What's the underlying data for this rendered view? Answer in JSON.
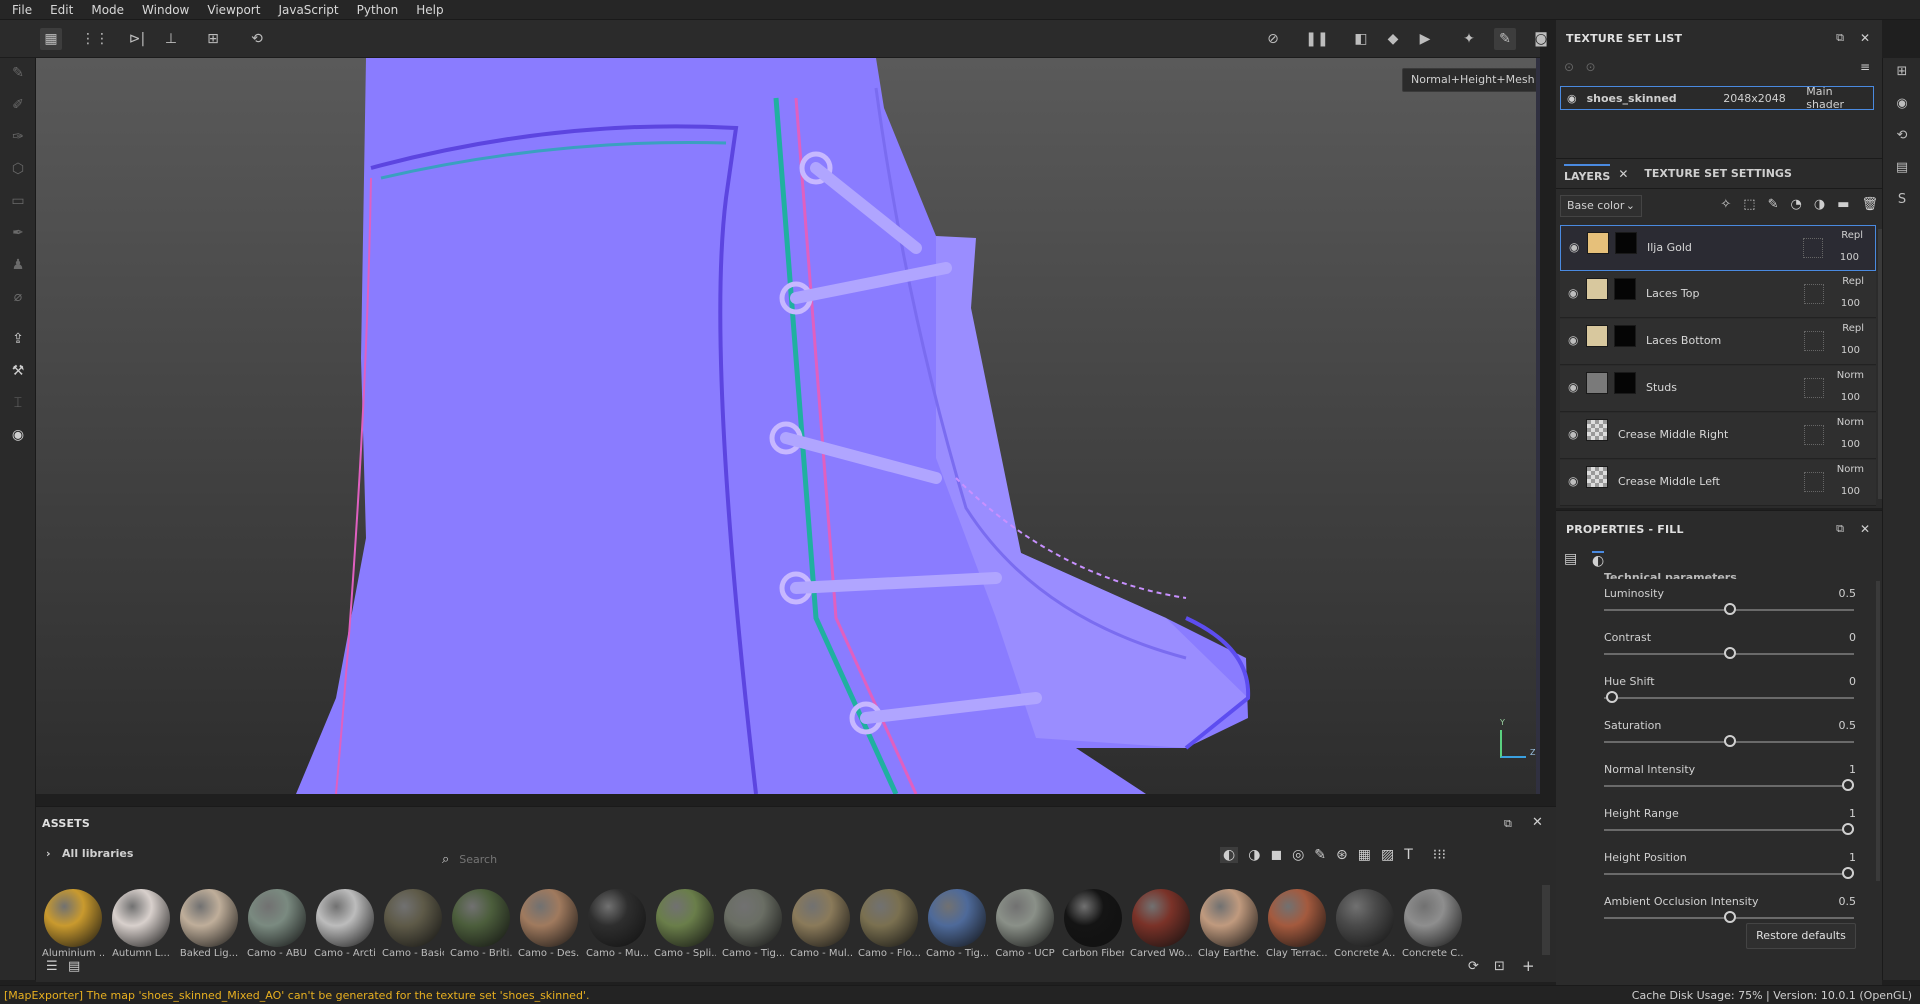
{
  "menu": [
    "File",
    "Edit",
    "Mode",
    "Window",
    "Viewport",
    "JavaScript",
    "Python",
    "Help"
  ],
  "viewport": {
    "mode_dropdown": "Normal+Height+Mesh",
    "axis_y": "Y",
    "axis_z": "Z"
  },
  "texture_set_list": {
    "title": "TEXTURE SET LIST",
    "item": {
      "name": "shoes_skinned",
      "resolution": "2048x2048",
      "shader": "Main shader"
    }
  },
  "layers": {
    "tab_layers": "LAYERS",
    "tab_settings": "TEXTURE SET SETTINGS",
    "channel_dropdown": "Base color",
    "items": [
      {
        "name": "Ilja Gold",
        "blend": "Repl",
        "opacity": "100",
        "color": "#e6c07a"
      },
      {
        "name": "Laces Top",
        "blend": "Repl",
        "opacity": "100",
        "color": "#d8c89e"
      },
      {
        "name": "Laces Bottom",
        "blend": "Repl",
        "opacity": "100",
        "color": "#d8c89e"
      },
      {
        "name": "Studs",
        "blend": "Norm",
        "opacity": "100",
        "color": "#7a7a7a"
      },
      {
        "name": "Crease Middle Right",
        "blend": "Norm",
        "opacity": "100",
        "color": "checker"
      },
      {
        "name": "Crease Middle Left",
        "blend": "Norm",
        "opacity": "100",
        "color": "checker"
      }
    ]
  },
  "properties": {
    "title": "PROPERTIES - FILL",
    "section": "Technical parameters",
    "params": [
      {
        "label": "Luminosity",
        "value": "0.5",
        "fraction": 0.5
      },
      {
        "label": "Contrast",
        "value": "0",
        "fraction": 0.5
      },
      {
        "label": "Hue Shift",
        "value": "0",
        "fraction": 0.0
      },
      {
        "label": "Saturation",
        "value": "0.5",
        "fraction": 0.5
      },
      {
        "label": "Normal Intensity",
        "value": "1",
        "fraction": 1.0
      },
      {
        "label": "Height Range",
        "value": "1",
        "fraction": 1.0
      },
      {
        "label": "Height Position",
        "value": "1",
        "fraction": 1.0
      },
      {
        "label": "Ambient Occlusion Intensity",
        "value": "0.5",
        "fraction": 0.5
      }
    ],
    "restore_button": "Restore defaults"
  },
  "assets": {
    "title": "ASSETS",
    "library": "All libraries",
    "search_placeholder": "Search",
    "items": [
      {
        "name": "Aluminium ...",
        "color": "#c99a2e"
      },
      {
        "name": "Autumn L...",
        "color": "#d8d0cc"
      },
      {
        "name": "Baked Lig...",
        "color": "#bfae9a"
      },
      {
        "name": "Camo - ABU",
        "color": "#7a8a80"
      },
      {
        "name": "Camo - Arctic",
        "color": "#bcbcbc"
      },
      {
        "name": "Camo - Basic",
        "color": "#5e5a48"
      },
      {
        "name": "Camo - Briti...",
        "color": "#4c5e3c"
      },
      {
        "name": "Camo - Des...",
        "color": "#a07a5e"
      },
      {
        "name": "Camo - Mu...",
        "color": "#2e2e2e"
      },
      {
        "name": "Camo - Spli...",
        "color": "#6a7e4a"
      },
      {
        "name": "Camo - Tig...",
        "color": "#6a6e64"
      },
      {
        "name": "Camo - Mul...",
        "color": "#8a7a5a"
      },
      {
        "name": "Camo - Flo...",
        "color": "#7a7050"
      },
      {
        "name": "Camo - Tig...",
        "color": "#4e6a9a"
      },
      {
        "name": "Camo - UCP",
        "color": "#8a9088"
      },
      {
        "name": "Carbon Fiber",
        "color": "#141414"
      },
      {
        "name": "Carved Wo...",
        "color": "#7a3228"
      },
      {
        "name": "Clay Earthe...",
        "color": "#c09a7e"
      },
      {
        "name": "Clay Terrac...",
        "color": "#a45a3e"
      },
      {
        "name": "Concrete A...",
        "color": "#4a4a4a"
      },
      {
        "name": "Concrete C...",
        "color": "#8e8e8e"
      }
    ]
  },
  "status": {
    "message": "[MapExporter] The map 'shoes_skinned_Mixed_AO' can't be generated for the texture set 'shoes_skinned'.",
    "right": "Cache Disk Usage:   75% | Version: 10.0.1 (OpenGL)"
  },
  "colors": {
    "normal_map": "#8a7cff",
    "accent": "#4a8ae0",
    "warning": "#e8b020"
  }
}
